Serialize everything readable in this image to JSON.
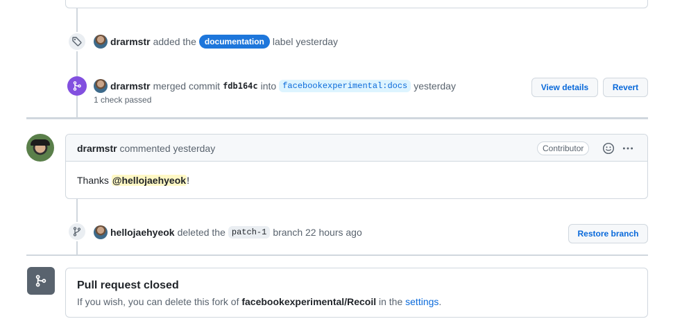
{
  "events": {
    "label_event": {
      "user": "drarmstr",
      "action": "added the",
      "label": "documentation",
      "suffix": "label yesterday",
      "label_color": "#1d76db"
    },
    "merge_event": {
      "user": "drarmstr",
      "action": "merged commit",
      "commit": "fdb164c",
      "into": "into",
      "target_branch": "facebookexperimental:docs",
      "time": "yesterday",
      "checks": "1 check passed",
      "view_details_label": "View details",
      "revert_label": "Revert"
    },
    "delete_branch_event": {
      "user": "hellojaehyeok",
      "action": "deleted the",
      "branch": "patch-1",
      "suffix": "branch 22 hours ago",
      "restore_label": "Restore branch"
    }
  },
  "comment": {
    "author": "drarmstr",
    "action": "commented yesterday",
    "role_badge": "Contributor",
    "body_prefix": "Thanks ",
    "mention": "@hellojaehyeok",
    "body_suffix": "!",
    "emoji_icon": "smiley-icon",
    "menu_icon": "kebab-horizontal-icon"
  },
  "closed": {
    "title": "Pull request closed",
    "msg_prefix": "If you wish, you can delete this fork of",
    "repo": "facebookexperimental/Recoil",
    "msg_mid": "in the",
    "settings_link": "settings",
    "msg_end": "."
  },
  "colors": {
    "merged": "#8250df",
    "link": "#0969da",
    "closed_icon_bg": "#59636e"
  }
}
